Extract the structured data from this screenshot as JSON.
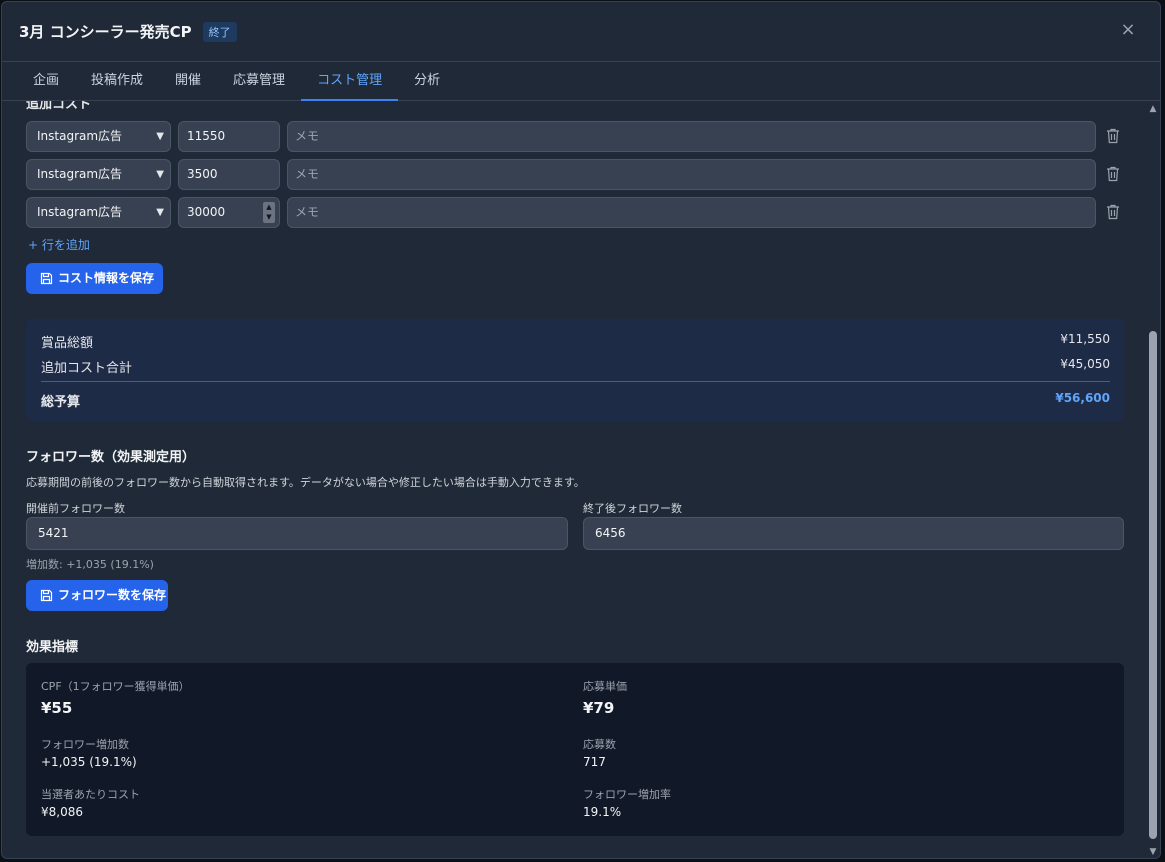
{
  "dialog": {
    "title": "3月 コンシーラー発売CP",
    "status_badge": "終了",
    "close_icon": "×"
  },
  "tabs": [
    {
      "label": "企画",
      "active": false
    },
    {
      "label": "投稿作成",
      "active": false
    },
    {
      "label": "開催",
      "active": false
    },
    {
      "label": "応募管理",
      "active": false
    },
    {
      "label": "コスト管理",
      "active": true
    },
    {
      "label": "分析",
      "active": false
    }
  ],
  "cost": {
    "section_title": "追加コスト",
    "rows": [
      {
        "type": "Instagram広告",
        "amount": "11550",
        "memo_placeholder": "メモ"
      },
      {
        "type": "Instagram広告",
        "amount": "3500",
        "memo_placeholder": "メモ"
      },
      {
        "type": "Instagram広告",
        "amount": "30000",
        "memo_placeholder": "メモ"
      }
    ],
    "add_row_label": "+ 行を追加",
    "save_button": "コスト情報を保存"
  },
  "summary": {
    "prize_total_label": "賞品総額",
    "prize_total_value": "¥11,550",
    "additional_cost_label": "追加コスト合計",
    "additional_cost_value": "¥45,050",
    "total_budget_label": "総予算",
    "total_budget_value": "¥56,600"
  },
  "followers": {
    "section_title": "フォロワー数（効果測定用）",
    "description": "応募期間の前後のフォロワー数から自動取得されます。データがない場合や修正したい場合は手動入力できます。",
    "before_label": "開催前フォロワー数",
    "before_value": "5421",
    "after_label": "終了後フォロワー数",
    "after_value": "6456",
    "increase_text": "増加数: +1,035 (19.1%)",
    "save_button": "フォロワー数を保存"
  },
  "metrics": {
    "section_title": "効果指標",
    "cpf_label": "CPF（1フォロワー獲得単価）",
    "cpf_value": "¥55",
    "cpa_label": "応募単価",
    "cpa_value": "¥79",
    "follower_increase_label": "フォロワー増加数",
    "follower_increase_value": "+1,035 (19.1%)",
    "entries_label": "応募数",
    "entries_value": "717",
    "cost_per_winner_label": "当選者あたりコスト",
    "cost_per_winner_value": "¥8,086",
    "follower_growth_label": "フォロワー増加率",
    "follower_growth_value": "19.1%"
  },
  "icons": {
    "row_delete": "trash-icon",
    "save": "save-icon",
    "select": "chevron-down-icon"
  },
  "colors": {
    "accent": "#2563eb",
    "accent_text": "#60a5fa",
    "panel": "#1f2937",
    "summary_bg": "#1e2b47"
  }
}
